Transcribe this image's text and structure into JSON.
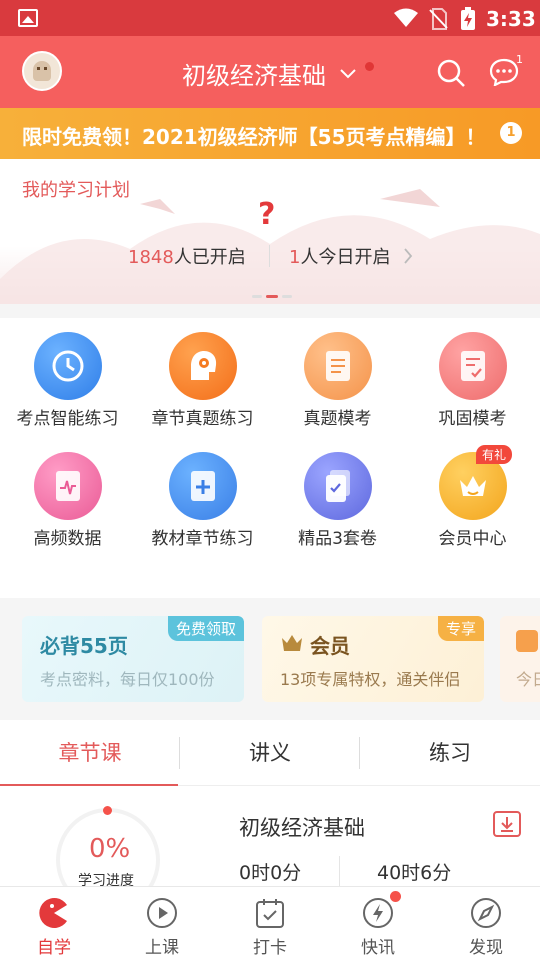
{
  "status_bar": {
    "time": "3:33",
    "icons": [
      "image-icon",
      "wifi-icon",
      "no-sim-icon",
      "battery-charging-icon"
    ]
  },
  "header": {
    "title": "初级经济基础",
    "message_count": "1",
    "icons": [
      "avatar",
      "chevron-down-icon",
      "search-icon",
      "message-icon"
    ]
  },
  "banner": {
    "text": "限时免费领！2021初级经济师【55页考点精编】！",
    "icon_text": "1"
  },
  "plan": {
    "title": "我的学习计划",
    "question_mark": "?",
    "started_count": "1848",
    "started_label": "人已开启",
    "today_count": "1",
    "today_label": "人今日开启"
  },
  "grid": {
    "items": [
      {
        "label": "考点智能练习",
        "icon": "clock-icon",
        "color": "#3d8ef5"
      },
      {
        "label": "章节真题练习",
        "icon": "head-gear-icon",
        "color": "#f57b22"
      },
      {
        "label": "真题模考",
        "icon": "document-icon",
        "color": "#f7a05c"
      },
      {
        "label": "巩固模考",
        "icon": "checklist-icon",
        "color": "#f27b7b"
      },
      {
        "label": "高频数据",
        "icon": "chart-icon",
        "color": "#ef6fa3"
      },
      {
        "label": "教材章节练习",
        "icon": "book-plus-icon",
        "color": "#4a90ef"
      },
      {
        "label": "精品3套卷",
        "icon": "papers-icon",
        "color": "#6f7ae8"
      },
      {
        "label": "会员中心",
        "icon": "crown-icon",
        "color": "#f7b82f"
      }
    ],
    "gift_badge": "有礼"
  },
  "promos": {
    "card1": {
      "title": "必背55页",
      "subtitle": "考点密料，每日仅100份",
      "tag": "免费领取"
    },
    "card2": {
      "title": "会员",
      "subtitle": "13项专属特权，通关伴侣",
      "tag": "专享"
    },
    "card3": {
      "subtitle": "今日"
    }
  },
  "tabs": [
    "章节课",
    "讲义",
    "练习"
  ],
  "course": {
    "percent": "0%",
    "progress_label": "学习进度",
    "title": "初级经济基础",
    "time_studied": "0时0分",
    "time_total": "40时6分"
  },
  "bottom_nav": [
    {
      "label": "自学",
      "icon": "pacman-icon"
    },
    {
      "label": "上课",
      "icon": "play-icon"
    },
    {
      "label": "打卡",
      "icon": "calendar-check-icon"
    },
    {
      "label": "快讯",
      "icon": "lightning-icon"
    },
    {
      "label": "发现",
      "icon": "compass-icon"
    }
  ]
}
